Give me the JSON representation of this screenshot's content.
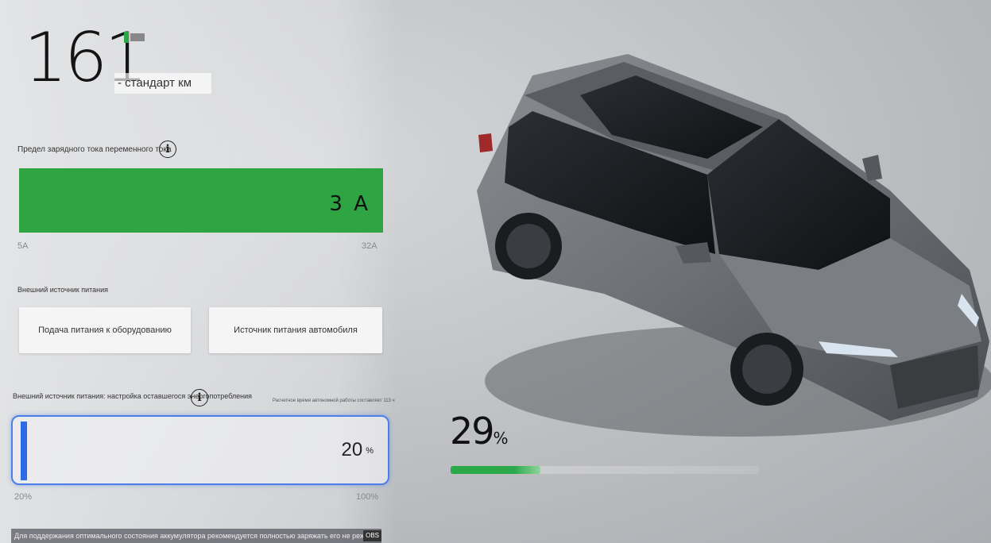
{
  "range": {
    "value": "161",
    "unit": "- стандарт км"
  },
  "charge_current": {
    "label": "Предел зарядного тока переменного тока",
    "value": "3 А",
    "scale_min": "5A",
    "scale_max": "32A"
  },
  "external_power": {
    "label": "Внешний источник питания",
    "buttons": [
      "Подача питания к оборудованию",
      "Источник питания автомобиля"
    ]
  },
  "reserve": {
    "label": "Внешний источник питания: настройка оставшегося энергопотребления",
    "hint": "Расчетное время автономной работы составляет 113 ч",
    "value": "20",
    "unit": "%",
    "scale_min": "20%",
    "scale_max": "100%"
  },
  "battery": {
    "soc_value": "29",
    "soc_unit": "%",
    "soc_fraction": 0.29
  },
  "footer_note": "Для поддержания оптимального состояния аккумулятора рекомендуется полностью заряжать его не реже одного раза в н",
  "footer_tag": "OBS",
  "colors": {
    "green": "#2ea542",
    "blue": "#2e6ce6"
  }
}
